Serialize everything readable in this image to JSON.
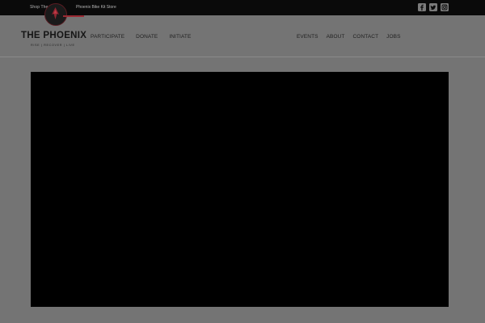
{
  "topbar": {
    "shop_link_start": "Shop The",
    "shop_link_end": "Phoenix Bike Kit Store",
    "social": [
      {
        "icon": "facebook-icon"
      },
      {
        "icon": "twitter-icon"
      },
      {
        "icon": "instagram-icon"
      }
    ]
  },
  "logo": {
    "title": "THE PHOENIX",
    "tagline": "RISE | RECOVER | LIVE"
  },
  "nav_left": [
    "PARTICIPATE",
    "DONATE",
    "INITIATE"
  ],
  "nav_right": [
    "EVENTS",
    "ABOUT",
    "CONTACT",
    "JOBS"
  ],
  "colors": {
    "page_background": "#747474",
    "topbar_background": "#0a0a0a",
    "brand_red": "#9a2a33",
    "video_background": "#000000"
  }
}
